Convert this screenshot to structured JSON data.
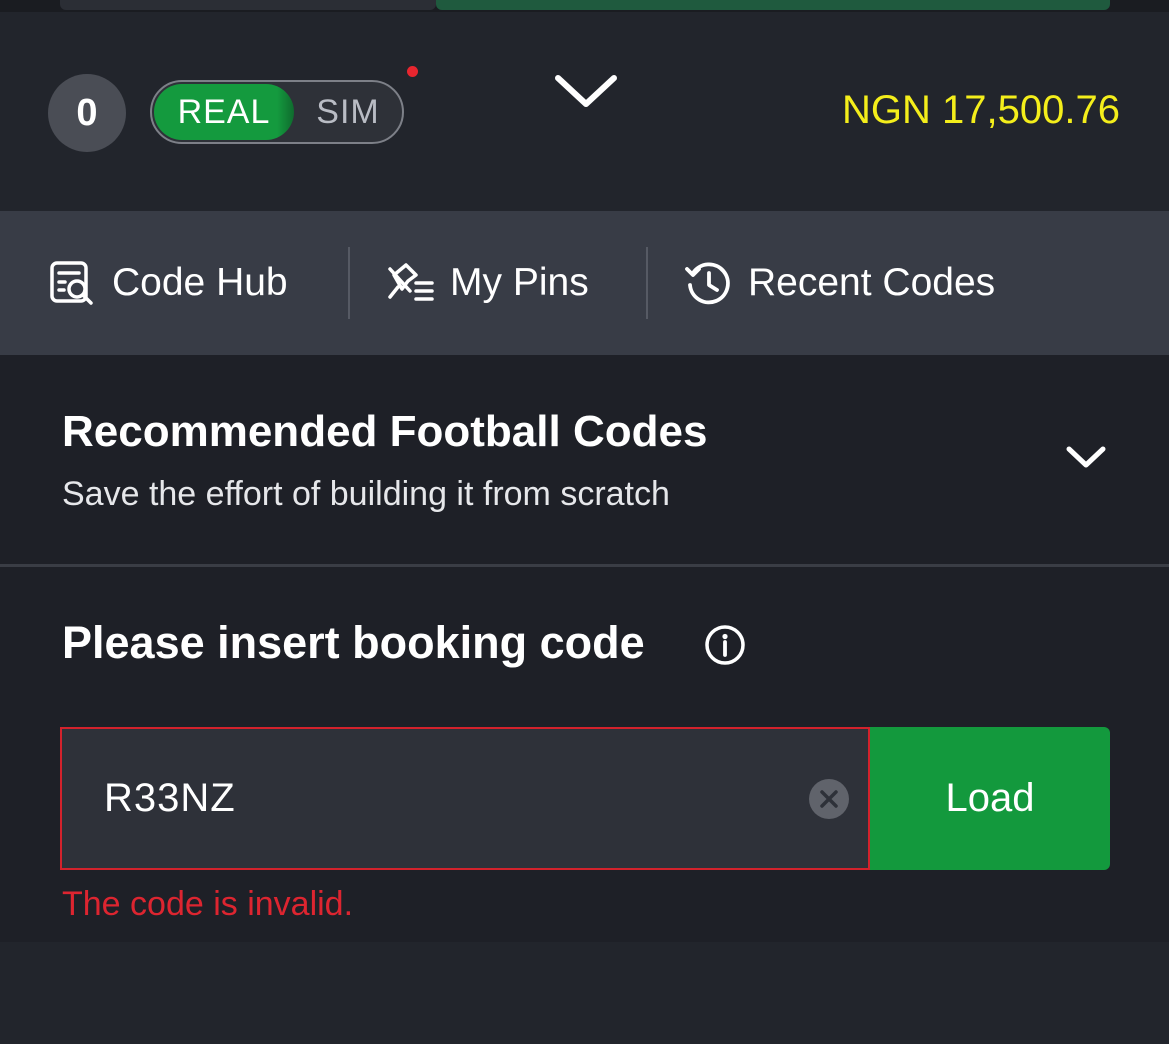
{
  "header": {
    "bet_count": "0",
    "mode_toggle": {
      "options": [
        "REAL",
        "SIM"
      ],
      "selected": "REAL"
    },
    "has_notification": true,
    "balance": "NGN 17,500.76"
  },
  "tabs": [
    {
      "label": "Code Hub",
      "icon": "code-hub-search-icon"
    },
    {
      "label": "My Pins",
      "icon": "pin-list-icon"
    },
    {
      "label": "Recent Codes",
      "icon": "history-icon"
    }
  ],
  "recommended": {
    "title": "Recommended Football Codes",
    "subtitle": "Save the effort of building it from scratch",
    "expanded": false
  },
  "booking": {
    "title": "Please insert booking code",
    "code_value": "R33NZ",
    "load_label": "Load",
    "error": "The code is invalid."
  },
  "colors": {
    "accent_green": "#13993d",
    "balance_yellow": "#f4ee1b",
    "error_red": "#dd2530",
    "notification_red": "#e8262f"
  }
}
